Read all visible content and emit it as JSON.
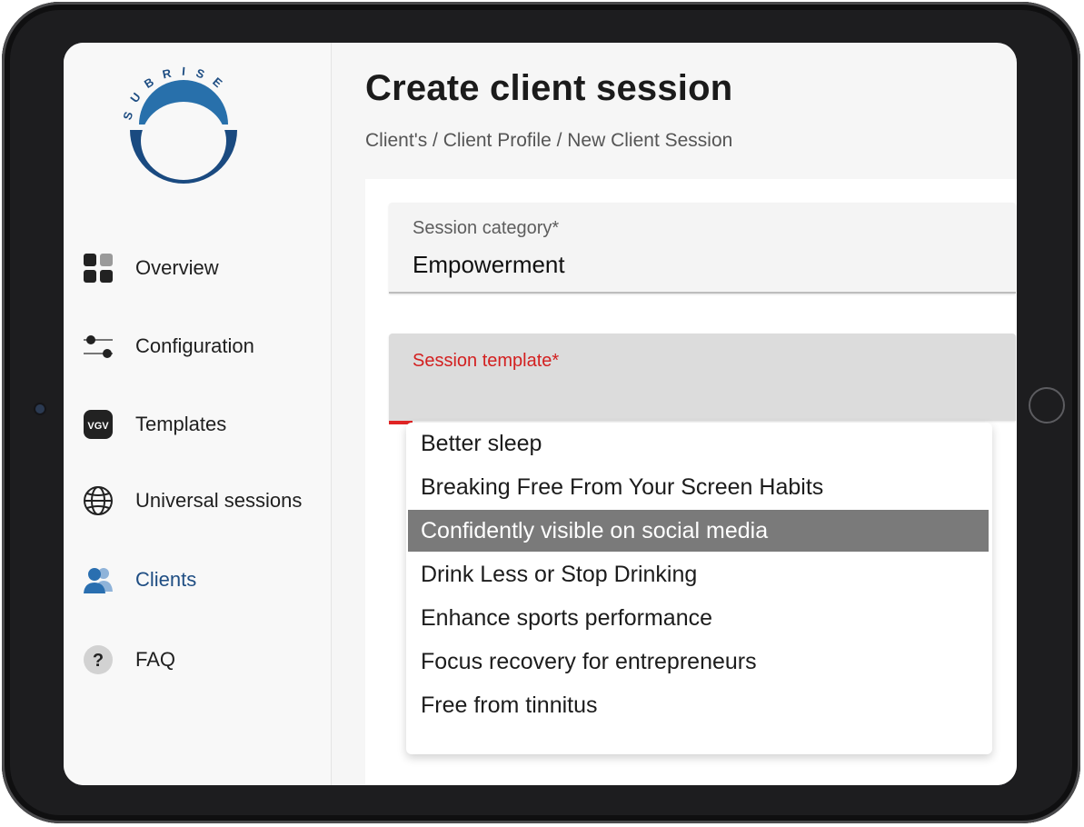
{
  "app": {
    "logo_text": "SUBRISE",
    "accent_color": "#1f4e83"
  },
  "sidebar": {
    "items": [
      {
        "label": "Overview",
        "icon": "grid-icon"
      },
      {
        "label": "Configuration",
        "icon": "sliders-icon"
      },
      {
        "label": "Templates",
        "icon": "templates-icon",
        "icon_text": "VGV"
      },
      {
        "label": "Universal sessions",
        "icon": "globe-icon"
      },
      {
        "label": "Clients",
        "icon": "users-icon",
        "active": true
      },
      {
        "label": "FAQ",
        "icon": "question-icon",
        "icon_text": "?"
      }
    ]
  },
  "main": {
    "title": "Create client session",
    "breadcrumb": "Client's / Client Profile / New Client Session"
  },
  "form": {
    "session_category": {
      "label": "Session category*",
      "value": "Empowerment"
    },
    "session_template": {
      "label": "Session template*",
      "value": "",
      "error_color": "#d32020",
      "options": [
        "Better sleep",
        "Breaking Free From Your Screen Habits",
        "Confidently visible on social media",
        "Drink Less or Stop Drinking",
        "Enhance sports performance",
        "Focus recovery for entrepreneurs",
        "Free from tinnitus"
      ],
      "highlighted_option": "Confidently visible on social media"
    }
  }
}
